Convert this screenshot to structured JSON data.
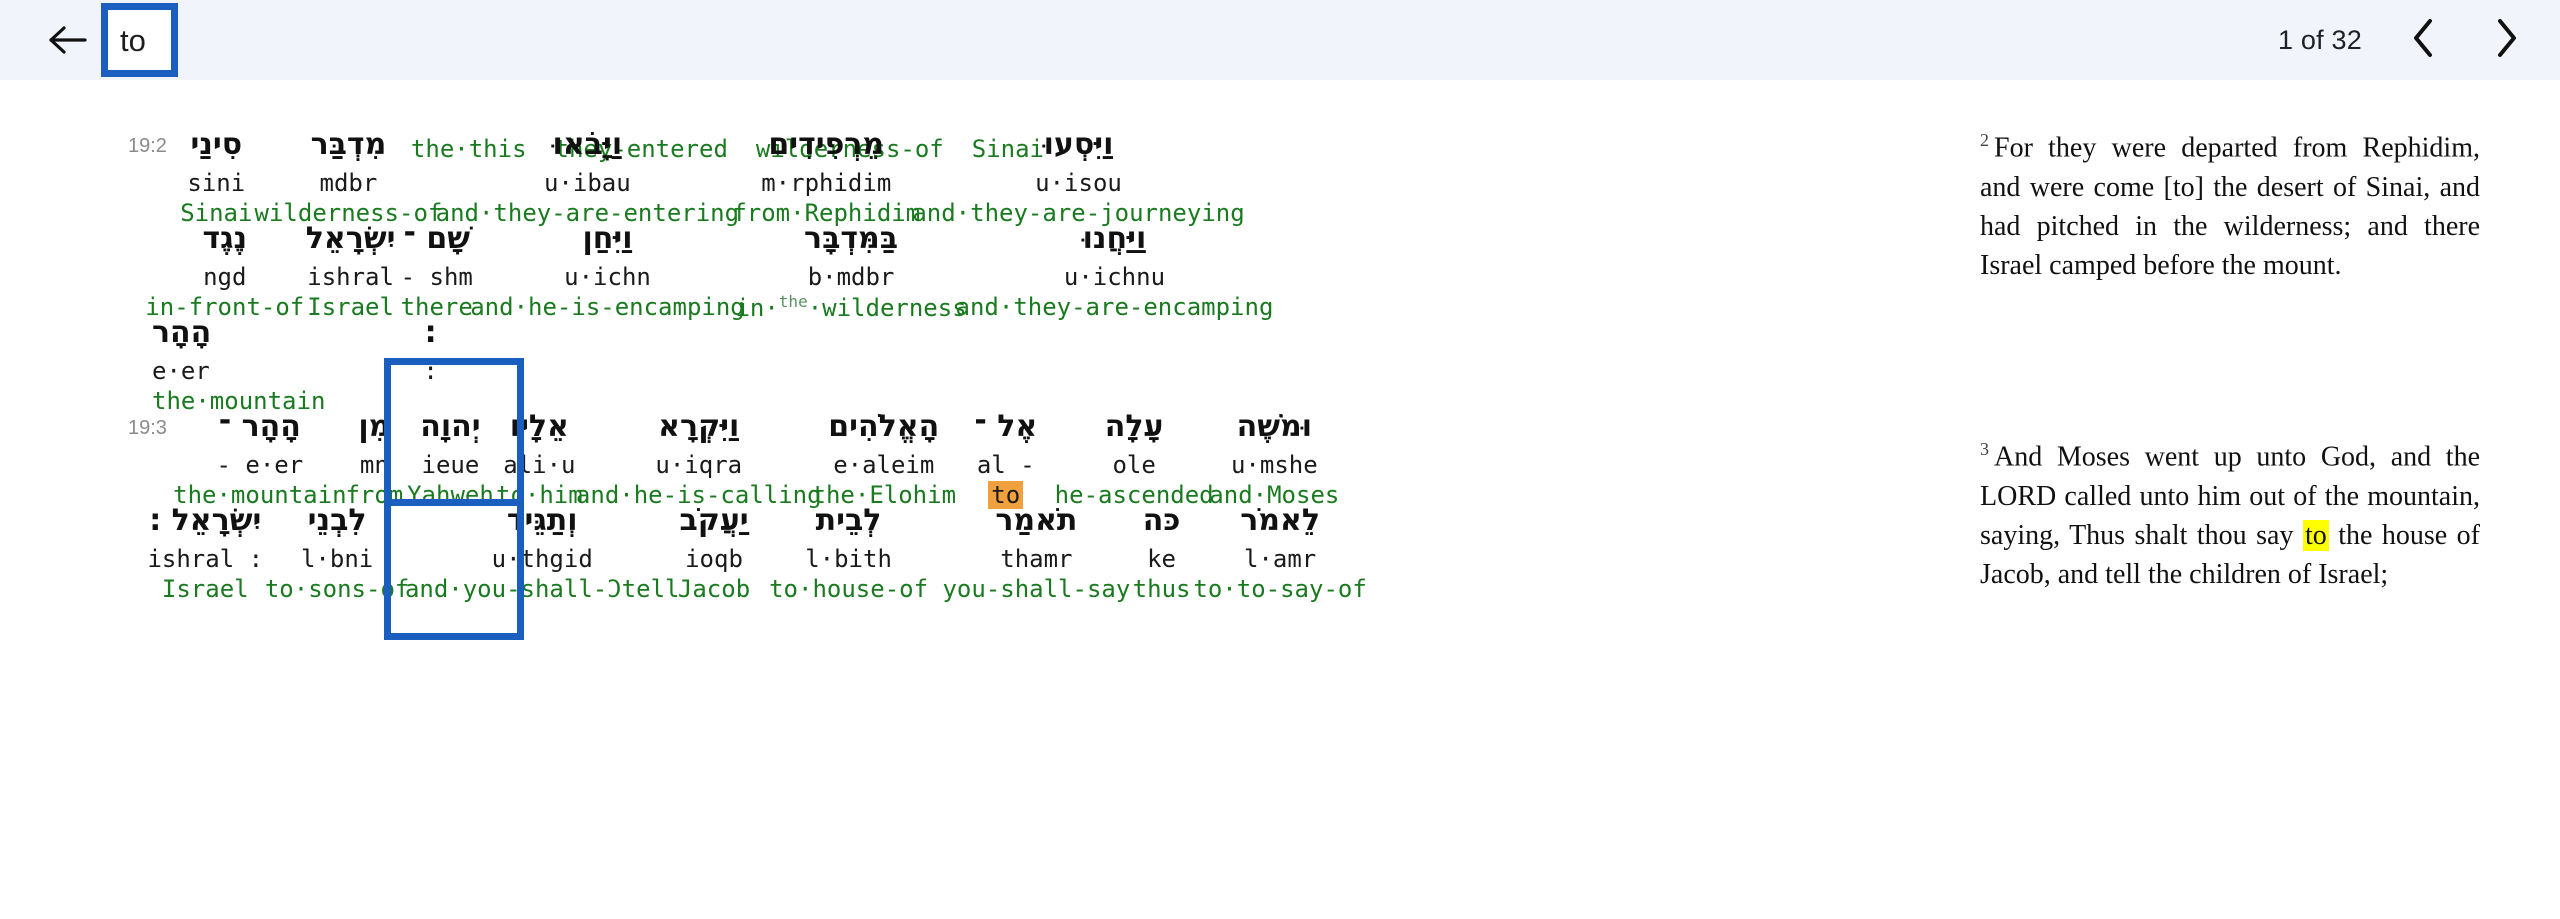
{
  "header": {
    "back_icon": "arrow-left-icon",
    "query_chip": {
      "text": "to"
    },
    "pager": {
      "count_label": "1 of 32",
      "prev_icon": "chevron-left-icon",
      "next_icon": "chevron-right-icon"
    },
    "bg_color": "#f1f5fb",
    "accent_color": "#1a5fc0"
  },
  "colors": {
    "gloss_green": "#1a7a1f",
    "highlight_orange": "#f0a03c",
    "highlight_yellow": "#ffff00",
    "annotation_blue": "#1a5fc0",
    "verse_number_gray": "#8b8b8b"
  },
  "interlinear": {
    "rows": [
      {
        "verse": "",
        "cells": [
          {
            "heb": "",
            "tlit": "",
            "gloss": "the·this"
          },
          {
            "heb": "",
            "tlit": "",
            "gloss": "they-entered"
          },
          {
            "heb": "",
            "tlit": "",
            "gloss": "wilderness-of"
          },
          {
            "heb": "",
            "tlit": "",
            "gloss": "Sinai"
          }
        ]
      },
      {
        "verse": "19:2",
        "cells": [
          {
            "heb": "וַיִּסְעוּ",
            "tlit": "u·isou",
            "gloss": "and·they-are-journeying"
          },
          {
            "heb": "מֵרְפִידִים",
            "tlit": "m·rphidim",
            "gloss": "from·Rephidim"
          },
          {
            "heb": "וַיָּבֹאוּ",
            "tlit": "u·ibau",
            "gloss": "and·they-are-entering"
          },
          {
            "heb": "מִדְבַּר",
            "tlit": "mdbr",
            "gloss": "wilderness-of"
          },
          {
            "heb": "סִינַי",
            "tlit": "sini",
            "gloss": "Sinai"
          }
        ]
      },
      {
        "verse": "",
        "cells": [
          {
            "heb": "וַיַּחֲנוּ",
            "tlit": "u·ichnu",
            "gloss": "and·they-are-encamping"
          },
          {
            "heb": "בַּמִּדְבָּר",
            "tlit": "b·mdbr",
            "gloss": "in·",
            "gloss_sup": "the",
            "gloss2": "·wilderness"
          },
          {
            "heb": "וַיִּחַן",
            "tlit": "u·ichn",
            "gloss": "and·he-is-encamping"
          },
          {
            "heb": "שָׁם ־",
            "tlit": "- shm",
            "gloss": "there"
          },
          {
            "heb": "יִשְׂרָאֵל",
            "tlit": "ishral",
            "gloss": "Israel"
          },
          {
            "heb": "נֶגֶד",
            "tlit": "ngd",
            "gloss": "in-front-of"
          }
        ]
      },
      {
        "verse": "",
        "cells": [
          {
            "heb": "הָהָר",
            "tlit": "e·er",
            "gloss": "the·mountain"
          },
          {
            "heb": ":",
            "tlit": ":",
            "gloss": ""
          }
        ]
      },
      {
        "verse": "19:3",
        "cells": [
          {
            "heb": "וּמֹשֶׁה",
            "tlit": "u·mshe",
            "gloss": "and·Moses"
          },
          {
            "heb": "עָלָה",
            "tlit": "ole",
            "gloss": "he-ascended"
          },
          {
            "heb": "אֶל ־",
            "tlit": "al -",
            "gloss": "to",
            "gloss_highlight": true
          },
          {
            "heb": "הָאֱלֹהִים",
            "tlit": "e·aleim",
            "gloss": "the·Elohim"
          },
          {
            "heb": "וַיִּקְרָא",
            "tlit": "u·iqra",
            "gloss": "and·he-is-calling"
          },
          {
            "heb": "אֵלָיו",
            "tlit": "ali·u",
            "gloss": "to·him"
          },
          {
            "heb": "יְהוָה",
            "tlit": "ieue",
            "gloss": "Yahweh"
          },
          {
            "heb": "מִן",
            "tlit": "mn",
            "gloss": "from"
          },
          {
            "heb": "הָהָר ־",
            "tlit": "- e·er",
            "gloss": "the·mountain"
          }
        ]
      },
      {
        "verse": "",
        "cells": [
          {
            "heb": "לֵאמֹר",
            "tlit": "l·amr",
            "gloss": "to·to-say-of"
          },
          {
            "heb": "כּה",
            "tlit": "ke",
            "gloss": "thus"
          },
          {
            "heb": "תֹאמַר",
            "tlit": "thamr",
            "gloss": "you-shall-say"
          },
          {
            "heb": "לְבֵית",
            "tlit": "l·bith",
            "gloss": "to·house-of"
          },
          {
            "heb": "יַעֲקֹב",
            "tlit": "ioqb",
            "gloss": "Jacob"
          },
          {
            "heb": "וְתַגֵּיד",
            "tlit": "u·thgid",
            "gloss": "and·you-shall-Ɔtell"
          },
          {
            "heb": "לִבְנֵי",
            "tlit": "l·bni",
            "gloss": "to·sons-of"
          },
          {
            "heb": "יִשְׂרָאֵל :",
            "tlit": "ishral :",
            "gloss": "Israel"
          }
        ]
      }
    ],
    "annotations": [
      {
        "name": "annotation-box-query-header"
      },
      {
        "name": "annotation-box-to-match"
      },
      {
        "name": "annotation-box-bottom-partial"
      }
    ]
  },
  "english": {
    "verses": [
      {
        "number": "2",
        "pre_highlight": "For they were departed from Rephidim, and were come [to] the desert of Sinai, and had pitched in the wilderness; and there Israel camped before the mount.",
        "highlight": "",
        "post_highlight": ""
      },
      {
        "number": "3",
        "pre_highlight": "And Moses went up unto God, and the LORD called unto him out of the mountain, saying, Thus shalt thou say ",
        "highlight": "to",
        "post_highlight": " the house of Jacob, and tell the children of Israel;"
      }
    ]
  }
}
